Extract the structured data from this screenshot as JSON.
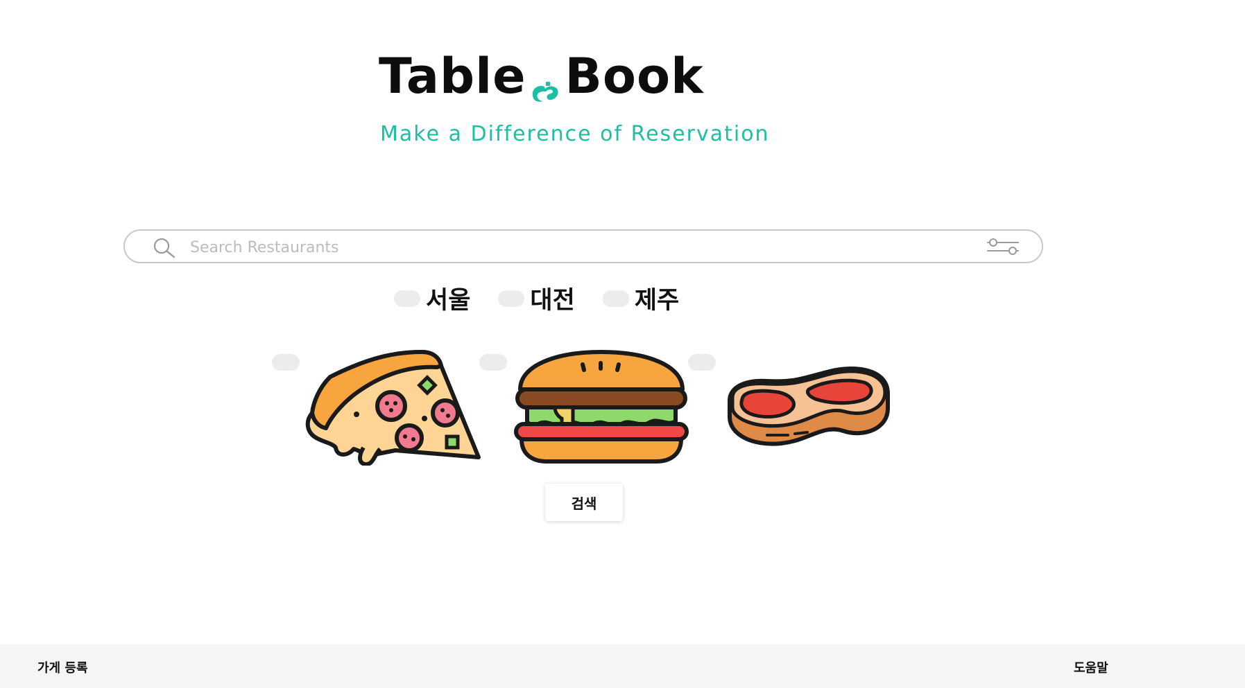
{
  "logo": {
    "left_text": "Table",
    "right_text": "Book",
    "tagline": "Make a Difference of Reservation",
    "accent_color": "#1bbfa3"
  },
  "search": {
    "placeholder": "Search Restaurants",
    "value": "",
    "icon": "search-icon",
    "filter_icon": "filter-sliders-icon"
  },
  "regions": [
    {
      "label": "서울",
      "checked": false
    },
    {
      "label": "대전",
      "checked": false
    },
    {
      "label": "제주",
      "checked": false
    }
  ],
  "foods": [
    {
      "icon": "pizza-icon",
      "checked": false
    },
    {
      "icon": "burger-icon",
      "checked": false
    },
    {
      "icon": "steak-icon",
      "checked": false
    }
  ],
  "search_button": {
    "label": "검색"
  },
  "footer": {
    "register_store": "가게 등록",
    "help": "도움말"
  }
}
